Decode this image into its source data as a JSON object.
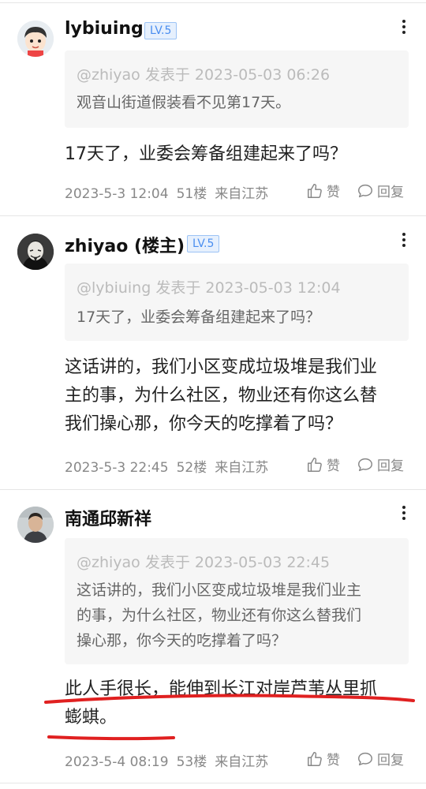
{
  "posts": [
    {
      "username": "lybiuing",
      "level": "LV.5",
      "quote_meta": "@zhiyao 发表于 2023-05-03 06:26",
      "quote_lines": [
        "观音山街道假装看不见第17天。"
      ],
      "content_lines": [
        "17天了，业委会筹备组建起来了吗？"
      ],
      "date": "2023-5-3 12:04",
      "floor": "51楼",
      "location": "来自江苏",
      "like_label": "赞",
      "reply_label": "回复"
    },
    {
      "username": "zhiyao (楼主)",
      "level": "LV.5",
      "quote_meta": "@lybiuing 发表于 2023-05-03 12:04",
      "quote_lines": [
        "17天了，业委会筹备组建起来了吗？"
      ],
      "content_lines": [
        "这话讲的，我们小区变成垃圾堆是我们业",
        "主的事，为什么社区，物业还有你这么替",
        "我们操心那，你今天的吃撑着了吗？"
      ],
      "date": "2023-5-3 22:45",
      "floor": "52楼",
      "location": "来自江苏",
      "like_label": "赞",
      "reply_label": "回复"
    },
    {
      "username": "南通邱新祥",
      "level": "",
      "quote_meta": "@zhiyao 发表于 2023-05-03 22:45",
      "quote_lines": [
        "这话讲的，我们小区变成垃圾堆是我们业主",
        "的事，为什么社区，物业还有你这么替我们",
        "操心那，你今天的吃撑着了吗？"
      ],
      "content_lines": [
        "此人手很长，能伸到长江对岸芦苇丛里抓",
        "蟛蜞。"
      ],
      "date": "2023-5-4 08:19",
      "floor": "53楼",
      "location": "来自江苏",
      "like_label": "赞",
      "reply_label": "回复"
    }
  ],
  "colors": {
    "accent": "#4a8ef0",
    "underline": "#e02020",
    "quote_bg": "#f6f6f6"
  }
}
